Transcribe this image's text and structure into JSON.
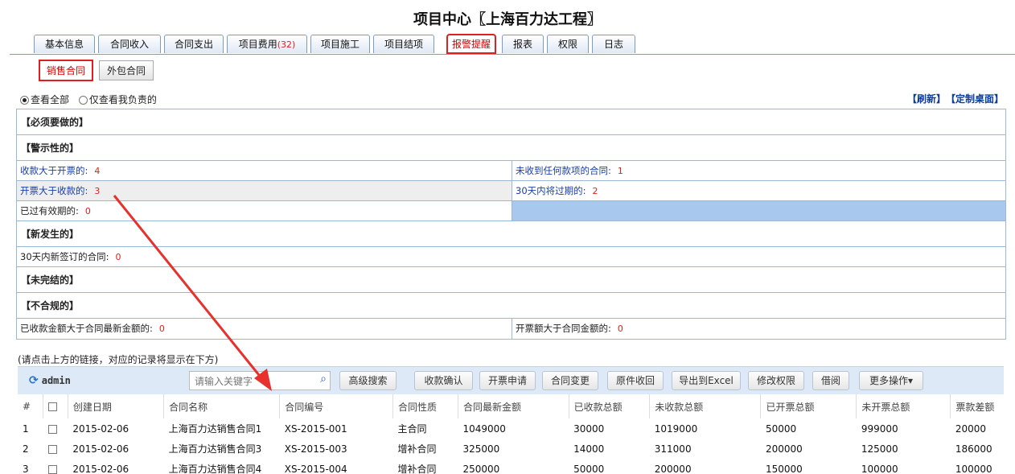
{
  "title": "项目中心〖上海百力达工程〗",
  "tabs": [
    {
      "label": "基本信息"
    },
    {
      "label": "合同收入"
    },
    {
      "label": "合同支出"
    },
    {
      "label": "项目费用",
      "count": "(32)"
    },
    {
      "label": "项目施工"
    },
    {
      "label": "项目结项"
    },
    {
      "label": "报警提醒"
    },
    {
      "label": "报表"
    },
    {
      "label": "权限"
    },
    {
      "label": "日志"
    }
  ],
  "subtabs": [
    {
      "label": "销售合同"
    },
    {
      "label": "外包合同"
    }
  ],
  "scope": {
    "all": "查看全部",
    "mine": "仅查看我负责的"
  },
  "toplinks": {
    "refresh": "【刷新】",
    "custom_desk": "【定制桌面】"
  },
  "alerts": {
    "must_do": "【必须要做的】",
    "warning": "【警示性的】",
    "received_gt_invoiced": "收款大于开票的:",
    "received_gt_invoiced_n": "4",
    "no_payment": "未收到任何款项的合同:",
    "no_payment_n": "1",
    "invoiced_gt_received": "开票大于收款的:",
    "invoiced_gt_received_n": "3",
    "expiring_30": "30天内将过期的:",
    "expiring_30_n": "2",
    "expired": "已过有效期的:",
    "expired_n": "0",
    "new": "【新发生的】",
    "signed_30": "30天内新签订的合同:",
    "signed_30_n": "0",
    "unfinished": "【未完结的】",
    "noncompliant": "【不合规的】",
    "received_gt_amount": "已收款金额大于合同最新金额的:",
    "received_gt_amount_n": "0",
    "invoice_gt_amount": "开票额大于合同金额的:",
    "invoice_gt_amount_n": "0"
  },
  "hint": "(请点击上方的链接，对应的记录将显示在下方)",
  "toolbar": {
    "user": "admin",
    "search_placeholder": "请输入关键字",
    "buttons": [
      "高级搜索",
      "收款确认",
      "开票申请",
      "合同变更",
      "原件收回",
      "导出到Excel",
      "修改权限",
      "借阅",
      "更多操作▾"
    ]
  },
  "table": {
    "headers": [
      "#",
      "",
      "创建日期",
      "合同名称",
      "合同编号",
      "合同性质",
      "合同最新金额",
      "已收款总额",
      "未收款总额",
      "已开票总额",
      "未开票总额",
      "票款差额"
    ],
    "rows": [
      [
        "1",
        "",
        "2015-02-06",
        "上海百力达销售合同1",
        "XS-2015-001",
        "主合同",
        "1049000",
        "30000",
        "1019000",
        "50000",
        "999000",
        "20000"
      ],
      [
        "2",
        "",
        "2015-02-06",
        "上海百力达销售合同3",
        "XS-2015-003",
        "增补合同",
        "325000",
        "14000",
        "311000",
        "200000",
        "125000",
        "186000"
      ],
      [
        "3",
        "",
        "2015-02-06",
        "上海百力达销售合同4",
        "XS-2015-004",
        "增补合同",
        "250000",
        "50000",
        "200000",
        "150000",
        "100000",
        "100000"
      ]
    ]
  },
  "colors": {
    "accent_red": "#e02020",
    "link_blue": "#1a3ea8",
    "toolbar_bg": "#dde9f7"
  }
}
